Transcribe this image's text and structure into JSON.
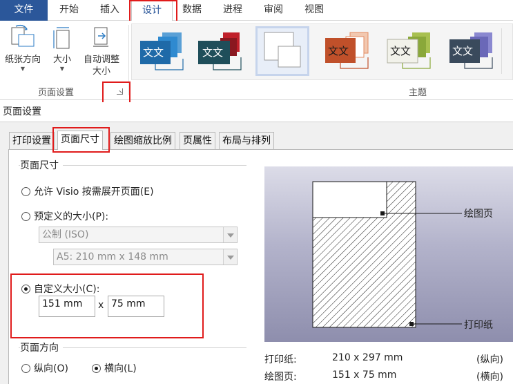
{
  "ribbon": {
    "tabs": [
      {
        "label": "文件"
      },
      {
        "label": "开始"
      },
      {
        "label": "插入"
      },
      {
        "label": "设计"
      },
      {
        "label": "数据"
      },
      {
        "label": "进程"
      },
      {
        "label": "审阅"
      },
      {
        "label": "视图"
      }
    ],
    "page_setup_group": {
      "label": "页面设置",
      "buttons": [
        {
          "label": "纸张方向",
          "icon": "orientation-icon"
        },
        {
          "label": "大小",
          "icon": "size-icon"
        },
        {
          "label": "自动调整\n大小",
          "line1": "自动调整",
          "line2": "大小",
          "icon": "auto-size-icon"
        }
      ]
    },
    "theme_group": {
      "label": "主题",
      "sample_text": "文文",
      "themes": [
        {
          "primary": "#1f6aa8",
          "secondary": "#2f8ad0",
          "text_color": "#ffffff"
        },
        {
          "primary": "#1f4e5a",
          "secondary": "#c0202a",
          "text_color": "#ffffff"
        },
        {
          "primary": "#ffffff",
          "secondary": "#ffffff",
          "text_color": "#ffffff"
        },
        {
          "primary": "#c0502a",
          "secondary": "#e28a60",
          "text_color": "#1a1a1a"
        },
        {
          "primary": "#f2f2ea",
          "secondary": "#8aa83a",
          "text_color": "#1a1a1a"
        },
        {
          "primary": "#3a4a5c",
          "secondary": "#6a68b8",
          "text_color": "#ffffff"
        }
      ]
    }
  },
  "dialog": {
    "title": "页面设置",
    "tabs": [
      {
        "label": "打印设置"
      },
      {
        "label": "页面尺寸"
      },
      {
        "label": "绘图缩放比例"
      },
      {
        "label": "页属性"
      },
      {
        "label": "布局与排列"
      }
    ],
    "page_size": {
      "section_title": "页面尺寸",
      "option_auto": "允许 Visio 按需展开页面(E)",
      "option_predefined": "预定义的大小(P):",
      "predefined_category": "公制 (ISO)",
      "predefined_size": "A5:  210 mm x 148 mm",
      "option_custom": "自定义大小(C):",
      "custom_width": "151 mm",
      "times": "x",
      "custom_height": "75 mm",
      "selected": "custom"
    },
    "orientation": {
      "section_title": "页面方向",
      "portrait": "纵向(O)",
      "landscape": "横向(L)",
      "selected": "landscape"
    },
    "preview": {
      "drawing_page_label": "绘图页",
      "printer_paper_label": "打印纸"
    },
    "info": {
      "paper_label": "打印纸:",
      "paper_size": "210 x 297 mm",
      "paper_orientation": "(纵向)",
      "drawing_label": "绘图页:",
      "drawing_size": "151 x 75 mm",
      "drawing_orientation": "(横向)"
    }
  },
  "colors": {
    "file_tab": "#2b579a",
    "highlight_box": "#e01b1b",
    "preview_bg_top": "#dcdce8",
    "preview_bg_bottom": "#8e8ead"
  }
}
